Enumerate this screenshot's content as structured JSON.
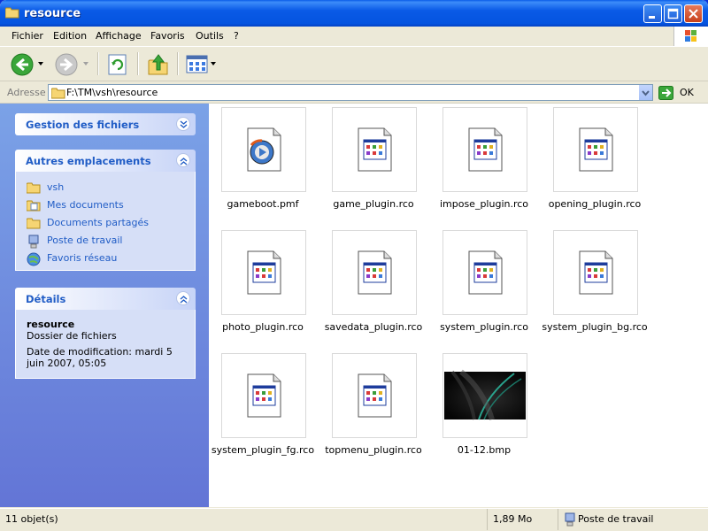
{
  "window": {
    "title": "resource"
  },
  "menu": [
    "Fichier",
    "Edition",
    "Affichage",
    "Favoris",
    "Outils",
    "?"
  ],
  "address": {
    "label": "Adresse",
    "path": "F:\\TM\\vsh\\resource",
    "go": "OK"
  },
  "panels": {
    "file_tasks": {
      "title": "Gestion des fichiers"
    },
    "other_places": {
      "title": "Autres emplacements",
      "links": [
        "vsh",
        "Mes documents",
        "Documents partagés",
        "Poste de travail",
        "Favoris réseau"
      ]
    },
    "details": {
      "title": "Détails",
      "name": "resource",
      "type": "Dossier de fichiers",
      "modified": "Date de modification: mardi 5 juin 2007, 05:05"
    }
  },
  "files": [
    {
      "name": "gameboot.pmf",
      "icon": "media-file-icon"
    },
    {
      "name": "game_plugin.rco",
      "icon": "rco-file-icon"
    },
    {
      "name": "impose_plugin.rco",
      "icon": "rco-file-icon"
    },
    {
      "name": "opening_plugin.rco",
      "icon": "rco-file-icon"
    },
    {
      "name": "photo_plugin.rco",
      "icon": "rco-file-icon"
    },
    {
      "name": "savedata_plugin.rco",
      "icon": "rco-file-icon"
    },
    {
      "name": "system_plugin.rco",
      "icon": "rco-file-icon"
    },
    {
      "name": "system_plugin_bg.rco",
      "icon": "rco-file-icon"
    },
    {
      "name": "system_plugin_fg.rco",
      "icon": "rco-file-icon"
    },
    {
      "name": "topmenu_plugin.rco",
      "icon": "rco-file-icon"
    },
    {
      "name": "01-12.bmp",
      "icon": "image-thumbnail"
    }
  ],
  "status": {
    "count": "11 objet(s)",
    "size": "1,89 Mo",
    "location": "Poste de travail"
  }
}
